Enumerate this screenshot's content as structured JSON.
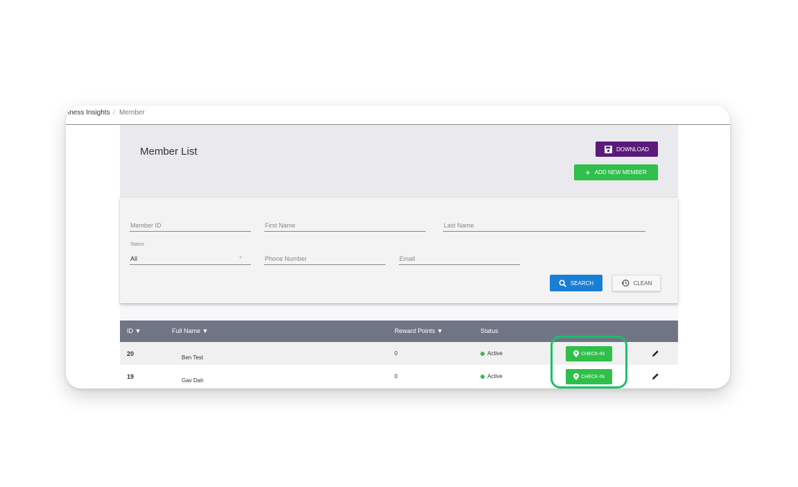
{
  "breadcrumb": {
    "parent": "siness Insights",
    "separator": "/",
    "current": "Member"
  },
  "page_title": "Member List",
  "actions": {
    "download_label": "DOWNLOAD",
    "add_label": "ADD NEW MEMBER"
  },
  "filters": {
    "member_id_placeholder": "Member ID",
    "first_name_placeholder": "First Name",
    "last_name_placeholder": "Last Name",
    "status_label": "Status",
    "status_value": "All",
    "phone_placeholder": "Phone Number",
    "email_placeholder": "Email",
    "search_label": "SEARCH",
    "clean_label": "CLEAN"
  },
  "table": {
    "columns": {
      "id": "ID ▼",
      "full_name": "Full Name ▼",
      "reward_points": "Reward Points ▼",
      "status": "Status"
    },
    "checkin_label": "CHECK-IN",
    "rows": [
      {
        "id": "20",
        "name": "Ben Test",
        "points": "0",
        "status": "Active"
      },
      {
        "id": "19",
        "name": "Gav Dah",
        "points": "0",
        "status": "Active"
      }
    ]
  },
  "colors": {
    "download": "#5a1a7a",
    "add": "#2fbf4a",
    "search": "#1a7fd4",
    "table_header": "#707585",
    "highlight": "#18c06a"
  }
}
